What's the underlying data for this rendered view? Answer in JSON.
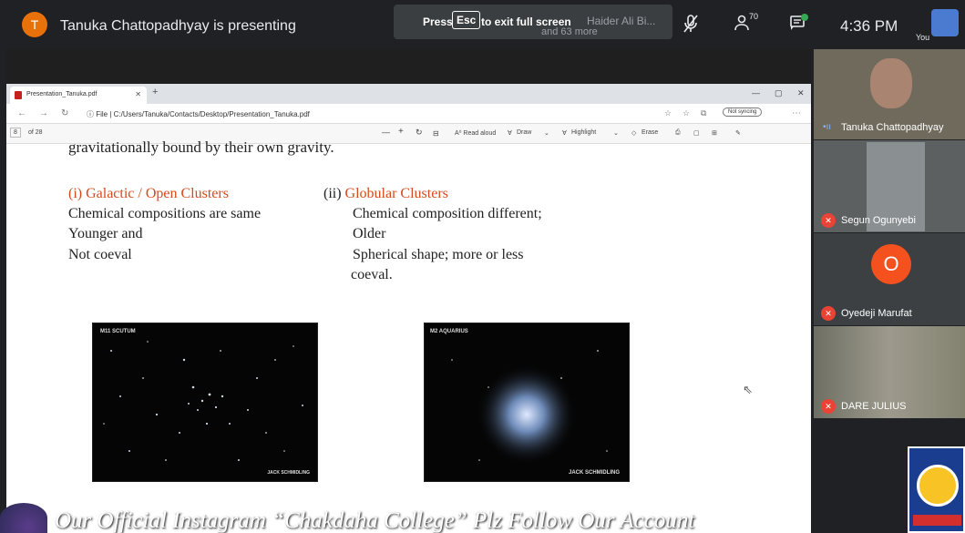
{
  "meet": {
    "presenter_initial": "T",
    "presenter_text": "Tanuka Chattopadhyay is presenting",
    "esc_hint": {
      "press": "Press",
      "key": "Esc",
      "message": "to exit full screen",
      "behind_name": "Haider Ali Bi...",
      "behind_more": "and 63 more"
    },
    "participant_count": "70",
    "chat_badge": "",
    "clock": "4:36 PM",
    "you_label": "You"
  },
  "browser": {
    "tab_title": "Presentation_Tanuka.pdf",
    "url_prefix": "File",
    "url": "C:/Users/Tanuka/Contacts/Desktop/Presentation_Tanuka.pdf",
    "sync_label": "Not syncing",
    "page_current": "8",
    "page_total": "of 28",
    "read_aloud": "A⁰ Read aloud",
    "draw": "Draw",
    "highlight": "Highlight",
    "erase": "Erase"
  },
  "slide": {
    "partial_line": "gravitationally bound by their own gravity.",
    "left_heading": "(i)  Galactic / Open Clusters",
    "left_lines": [
      "Chemical compositions are same",
      "Younger and",
      "Not coeval"
    ],
    "right_heading_prefix": "(ii) ",
    "right_heading": "Globular Clusters",
    "right_lines": [
      "Chemical composition different;",
      "Older",
      "Spherical shape;  more or less",
      "coeval."
    ],
    "image1_label": "M11 SCUTUM",
    "image1_credit": "JACK SCHMIDLING",
    "image2_label": "M2 AQUARIUS",
    "image2_credit": "JACK SCHMIDLING"
  },
  "watermark": "Our Official  Instagram “Chakdaha College” Plz  Follow Our Account",
  "participants": [
    {
      "name": "Tanuka Chattopadhyay"
    },
    {
      "name": "Segun Ogunyebi"
    },
    {
      "name": "Oyedeji Marufat",
      "initial": "O"
    },
    {
      "name": "DARE JULIUS"
    }
  ],
  "colors": {
    "accent_orange": "#d54a1c",
    "mic_muted": "#ea4335",
    "avatar_orange": "#f4511e"
  }
}
